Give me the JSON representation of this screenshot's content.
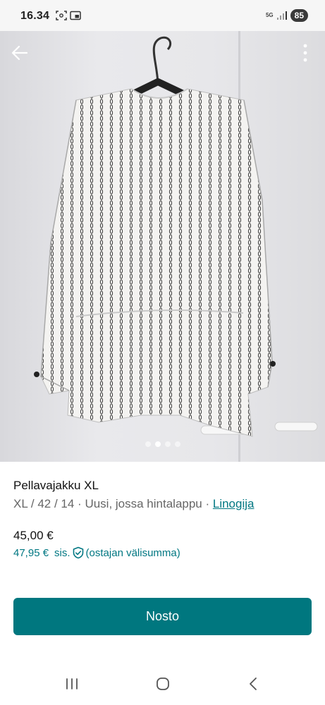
{
  "status_bar": {
    "time": "16.34",
    "network": "5G",
    "battery": "85"
  },
  "photo": {
    "description_icon_back": "arrow-left-icon",
    "description_icon_more": "more-vertical-icon",
    "pages_total": 4,
    "page_active": 2
  },
  "item": {
    "title": "Pellavajakku XL",
    "sizes": "XL / 42 / 14",
    "separator1": " · ",
    "condition": "Uusi, jossa hintalappu",
    "separator2": " · ",
    "brand": "Linogija",
    "price": "45,00 €",
    "buyer_price": "47,95 €",
    "buyer_price_sis": "sis.",
    "buyer_price_note": "(ostajan välisumma)"
  },
  "actions": {
    "buy_label": "Nosto"
  },
  "colors": {
    "accent": "#007782",
    "button": "#00777f"
  }
}
